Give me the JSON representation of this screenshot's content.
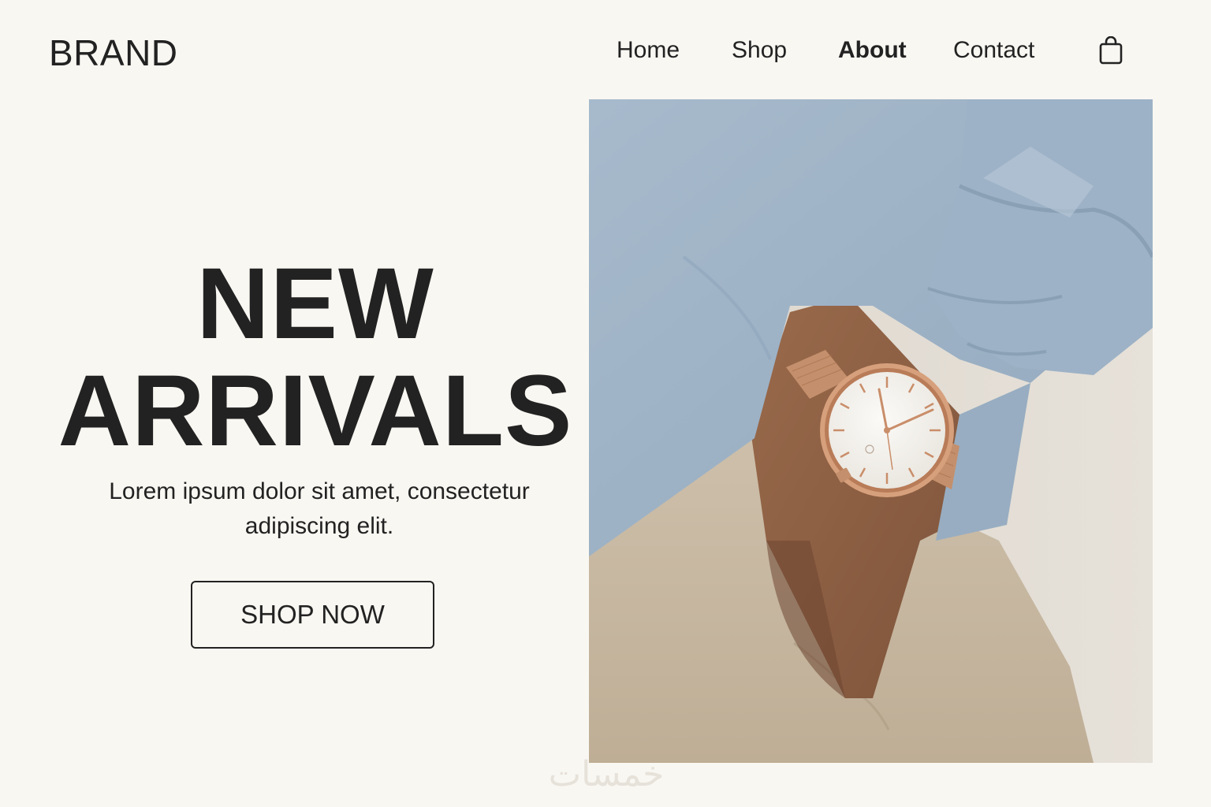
{
  "header": {
    "brand": "BRAND",
    "nav": [
      {
        "label": "Home",
        "active": false
      },
      {
        "label": "Shop",
        "active": false
      },
      {
        "label": "About",
        "active": true
      },
      {
        "label": "Contact",
        "active": false
      }
    ],
    "cart_icon": "shopping-bag-icon"
  },
  "hero": {
    "title_line1": "NEW",
    "title_line2": "ARRIVALS",
    "subtitle_line1": "Lorem ipsum dolor sit amet, consectetur",
    "subtitle_line2": "adipiscing elit.",
    "cta_label": "SHOP NOW",
    "image_subject": "wristwatch-on-wrist-photo"
  },
  "watermark": "خمسات",
  "colors": {
    "background": "#f9f7f2",
    "text": "#222222",
    "shirt": "#9fb4c8",
    "trousers": "#c7b8a2",
    "watch_gold": "#c98e6a"
  }
}
